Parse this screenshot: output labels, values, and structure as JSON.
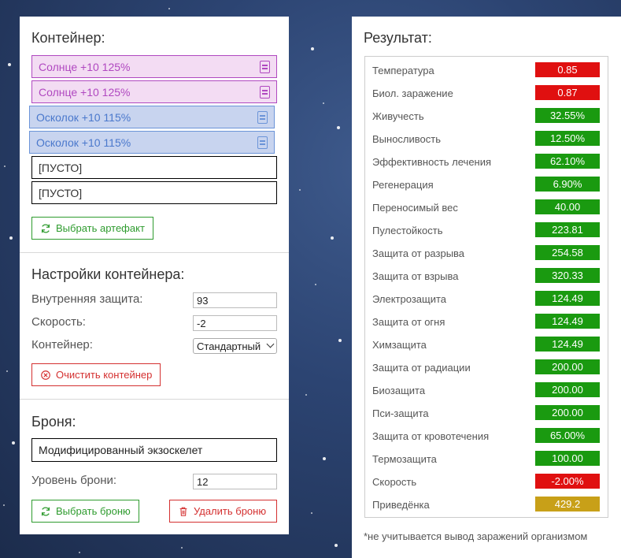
{
  "container": {
    "title": "Контейнер:",
    "slots": [
      {
        "label": "Солнце +10 125%",
        "kind": "sun"
      },
      {
        "label": "Солнце +10 125%",
        "kind": "sun"
      },
      {
        "label": "Осколок +10 115%",
        "kind": "shard"
      },
      {
        "label": "Осколок +10 115%",
        "kind": "shard"
      },
      {
        "label": "[ПУСТО]",
        "kind": "empty"
      },
      {
        "label": "[ПУСТО]",
        "kind": "empty"
      }
    ],
    "select_artifact_label": "Выбрать артефакт"
  },
  "settings": {
    "title": "Настройки контейнера:",
    "inner_protection_label": "Внутренняя защита:",
    "inner_protection_value": "93",
    "speed_label": "Скорость:",
    "speed_value": "-2",
    "container_label": "Контейнер:",
    "container_value": "Стандартный",
    "clear_label": "Очистить контейнер"
  },
  "armor": {
    "title": "Броня:",
    "name": "Модифицированный экзоскелет",
    "level_label": "Уровень брони:",
    "level_value": "12",
    "select_label": "Выбрать броню",
    "delete_label": "Удалить броню"
  },
  "result": {
    "title": "Результат:",
    "rows": [
      {
        "label": "Температура",
        "value": "0.85",
        "status": "bad"
      },
      {
        "label": "Биол. заражение",
        "value": "0.87",
        "status": "bad"
      },
      {
        "label": "Живучесть",
        "value": "32.55%",
        "status": "good"
      },
      {
        "label": "Выносливость",
        "value": "12.50%",
        "status": "good"
      },
      {
        "label": "Эффективность лечения",
        "value": "62.10%",
        "status": "good"
      },
      {
        "label": "Регенерация",
        "value": "6.90%",
        "status": "good"
      },
      {
        "label": "Переносимый вес",
        "value": "40.00",
        "status": "good"
      },
      {
        "label": "Пулестойкость",
        "value": "223.81",
        "status": "good"
      },
      {
        "label": "Защита от разрыва",
        "value": "254.58",
        "status": "good"
      },
      {
        "label": "Защита от взрыва",
        "value": "320.33",
        "status": "good"
      },
      {
        "label": "Электрозащита",
        "value": "124.49",
        "status": "good"
      },
      {
        "label": "Защита от огня",
        "value": "124.49",
        "status": "good"
      },
      {
        "label": "Химзащита",
        "value": "124.49",
        "status": "good"
      },
      {
        "label": "Защита от радиации",
        "value": "200.00",
        "status": "good"
      },
      {
        "label": "Биозащита",
        "value": "200.00",
        "status": "good"
      },
      {
        "label": "Пси-защита",
        "value": "200.00",
        "status": "good"
      },
      {
        "label": "Защита от кровотечения",
        "value": "65.00%",
        "status": "good"
      },
      {
        "label": "Термозащита",
        "value": "100.00",
        "status": "good"
      },
      {
        "label": "Скорость",
        "value": "-2.00%",
        "status": "bad"
      },
      {
        "label": "Приведёнка",
        "value": "429.2",
        "status": "gold"
      }
    ],
    "note": "*не учитывается вывод заражений организмом"
  },
  "colors": {
    "good": "#1a9a10",
    "bad": "#e01010",
    "gold": "#c8a018",
    "accent_green": "#2e9b2e",
    "accent_red": "#d43030"
  }
}
